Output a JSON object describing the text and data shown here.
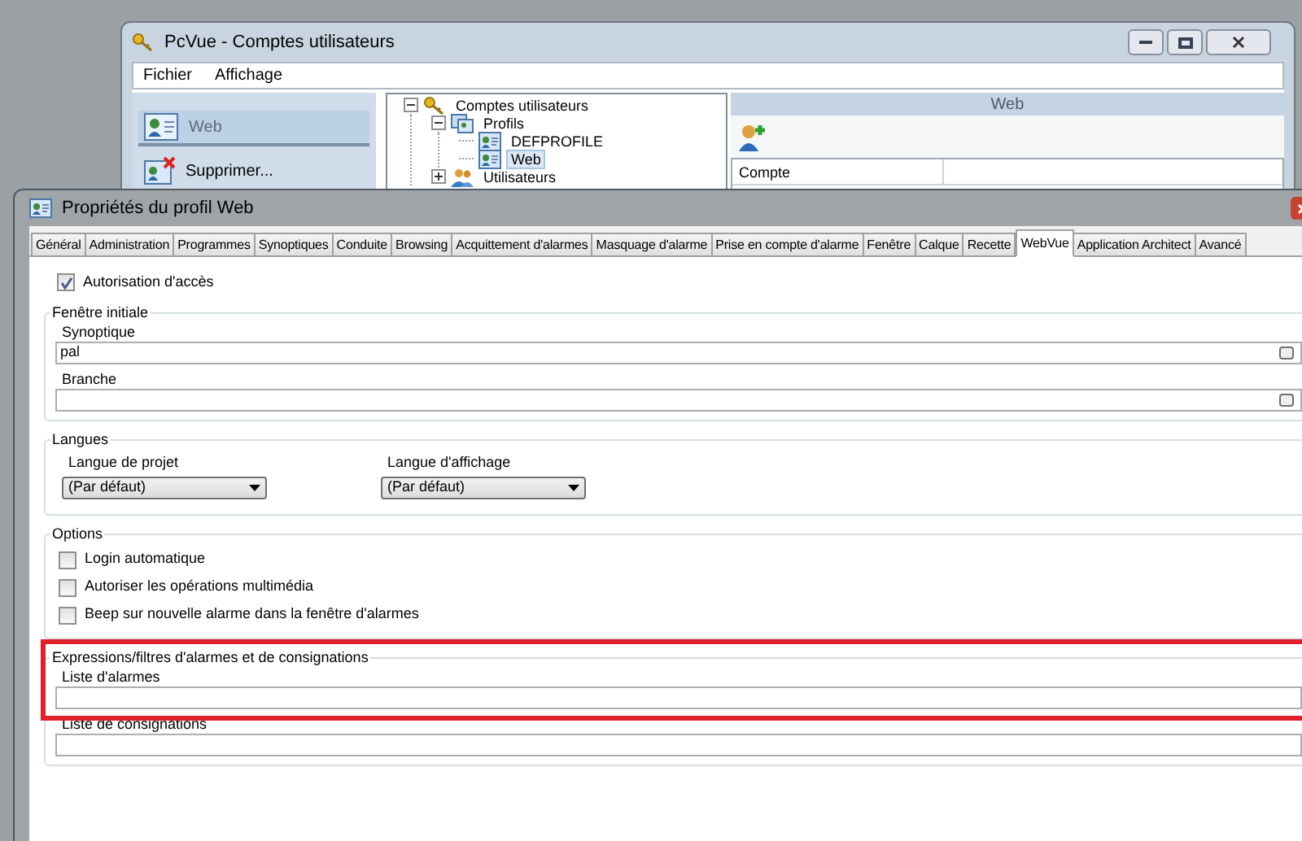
{
  "background_window": {
    "title": "PcVue - Comptes utilisateurs",
    "menu": [
      "Fichier",
      "Affichage"
    ],
    "sidebar": {
      "items": [
        {
          "label": "Web",
          "selected": true,
          "kind": "profile"
        },
        {
          "label": "Supprimer...",
          "selected": false,
          "kind": "delete"
        }
      ]
    },
    "tree": [
      {
        "label": "Comptes utilisateurs",
        "kind": "root",
        "expanded": true,
        "selected": false,
        "children": [
          {
            "label": "Profils",
            "kind": "group",
            "expanded": true,
            "selected": false,
            "children": [
              {
                "label": "DEFPROFILE",
                "kind": "profile",
                "selected": false
              },
              {
                "label": "Web",
                "kind": "profile",
                "selected": true
              }
            ]
          },
          {
            "label": "Utilisateurs",
            "kind": "users",
            "expanded": false,
            "selected": false
          }
        ]
      }
    ],
    "panel": {
      "title": "Web",
      "columns": [
        "Compte"
      ]
    }
  },
  "dialog": {
    "title": "Propriétés du profil Web",
    "tabs": [
      {
        "label": "Général",
        "selected": false
      },
      {
        "label": "Administration",
        "selected": false
      },
      {
        "label": "Programmes",
        "selected": false
      },
      {
        "label": "Synoptiques",
        "selected": false
      },
      {
        "label": "Conduite",
        "selected": false
      },
      {
        "label": "Browsing",
        "selected": false
      },
      {
        "label": "Acquittement d'alarmes",
        "selected": false
      },
      {
        "label": "Masquage d'alarme",
        "selected": false
      },
      {
        "label": "Prise en compte d'alarme",
        "selected": false
      },
      {
        "label": "Fenêtre",
        "selected": false
      },
      {
        "label": "Calque",
        "selected": false
      },
      {
        "label": "Recette",
        "selected": false
      },
      {
        "label": "WebVue",
        "selected": true
      },
      {
        "label": "Application Architect",
        "selected": false
      },
      {
        "label": "Avancé",
        "selected": false
      }
    ],
    "access": {
      "label": "Autorisation d'accès",
      "checked": true
    },
    "groups": [
      {
        "title": "Fenêtre initiale",
        "kind": "fields",
        "highlighted": false,
        "items": [
          {
            "label": "Synoptique",
            "value": "pal",
            "browse": true
          },
          {
            "label": "Branche",
            "browse": true
          }
        ]
      },
      {
        "title": "Langues",
        "kind": "selects",
        "highlighted": false,
        "items": [
          {
            "label": "Langue de projet",
            "value": "(Par défaut)"
          },
          {
            "label": "Langue d'affichage",
            "value": "(Par défaut)"
          }
        ]
      },
      {
        "title": "Options",
        "kind": "checks",
        "highlighted": false,
        "items": [
          {
            "label": "Login automatique",
            "checked": false
          },
          {
            "label": "Autoriser les opérations multimédia",
            "checked": false
          },
          {
            "label": "Beep sur nouvelle alarme dans la fenêtre d'alarmes",
            "checked": false
          }
        ]
      },
      {
        "title": "Expressions/filtres d'alarmes et de consignations",
        "kind": "fields",
        "highlighted": true,
        "items": [
          {
            "label": "Liste d'alarmes",
            "browse": false
          },
          {
            "label": "Liste de consignations",
            "browse": false
          }
        ]
      }
    ]
  }
}
